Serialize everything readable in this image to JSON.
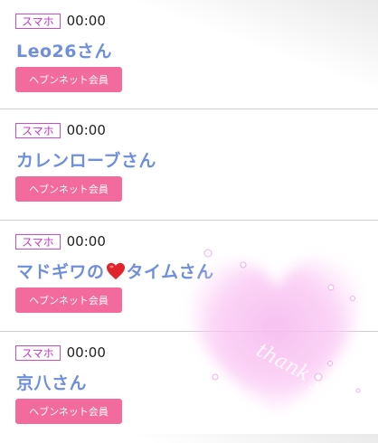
{
  "entries": [
    {
      "device": "スマホ",
      "time": "00:00",
      "name": "Leo26さん",
      "button": "ヘブンネット会員"
    },
    {
      "device": "スマホ",
      "time": "00:00",
      "name": "カレンローブさん",
      "button": "ヘブンネット会員"
    },
    {
      "device": "スマホ",
      "time": "00:00",
      "name_before": "マドギワの",
      "name_after": "タイムさん",
      "button": "ヘブンネット会員"
    },
    {
      "device": "スマホ",
      "time": "00:00",
      "name": "京八さん",
      "button": "ヘブンネット会員"
    }
  ],
  "decoration": {
    "text": "thank you",
    "color": "#ffd2f5"
  }
}
